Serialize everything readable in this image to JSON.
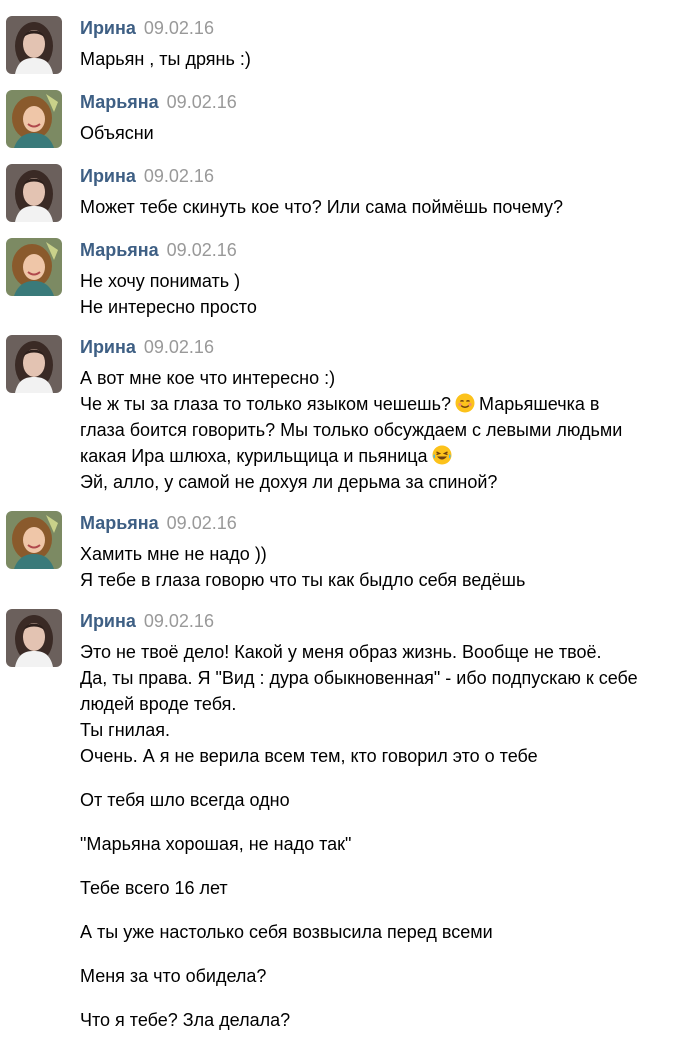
{
  "messages": [
    {
      "author": "Ирина",
      "date": "09.02.16",
      "avatar_icon": "irina-avatar-icon",
      "lines": [
        "Марьян , ты дрянь :)"
      ]
    },
    {
      "author": "Марьяна",
      "date": "09.02.16",
      "avatar_icon": "maryana-avatar-icon",
      "lines": [
        "Объясни"
      ]
    },
    {
      "author": "Ирина",
      "date": "09.02.16",
      "avatar_icon": "irina-avatar-icon",
      "lines": [
        "Может тебе скинуть кое что? Или сама поймёшь почему?"
      ]
    },
    {
      "author": "Марьяна",
      "date": "09.02.16",
      "avatar_icon": "maryana-avatar-icon",
      "lines": [
        "Не хочу понимать )",
        "Не интересно просто"
      ]
    },
    {
      "author": "Ирина",
      "date": "09.02.16",
      "avatar_icon": "irina-avatar-icon",
      "lines": [
        "А вот мне кое что интересно :)",
        "Че ж ты за глаза то только языком чешешь?",
        "Марьяшечка в",
        "глаза боится говорить? Мы только обсуждаем с левыми людьми",
        "какая Ира шлюха, курильщица и пьяница",
        "Эй, алло, у самой не дохуя ли дерьма за спиной?"
      ],
      "emoji": [
        "smiling-emoji-icon",
        "laughing-tears-emoji-icon"
      ]
    },
    {
      "author": "Марьяна",
      "date": "09.02.16",
      "avatar_icon": "maryana-avatar-icon",
      "lines": [
        "Хамить мне не надо ))",
        "Я тебе в глаза говорю что ты как быдло себя ведёшь"
      ]
    },
    {
      "author": "Ирина",
      "date": "09.02.16",
      "avatar_icon": "irina-avatar-icon",
      "lines": [
        "Это не твоё дело! Какой у меня образ жизнь. Вообще не твоё.",
        "Да, ты права. Я \"Вид : дура обыкновенная\" - ибо подпускаю к себе",
        "людей вроде тебя.",
        "Ты гнилая.",
        "Очень. А я не верила всем тем, кто говорил это о тебе",
        "От тебя шло всегда одно",
        "\"Марьяна хорошая, не надо так\"",
        "Тебе всего 16 лет",
        "А ты уже настолько себя возвысила перед всеми",
        "Меня за что обидела?",
        "Что я тебе? Зла делала?"
      ]
    }
  ]
}
